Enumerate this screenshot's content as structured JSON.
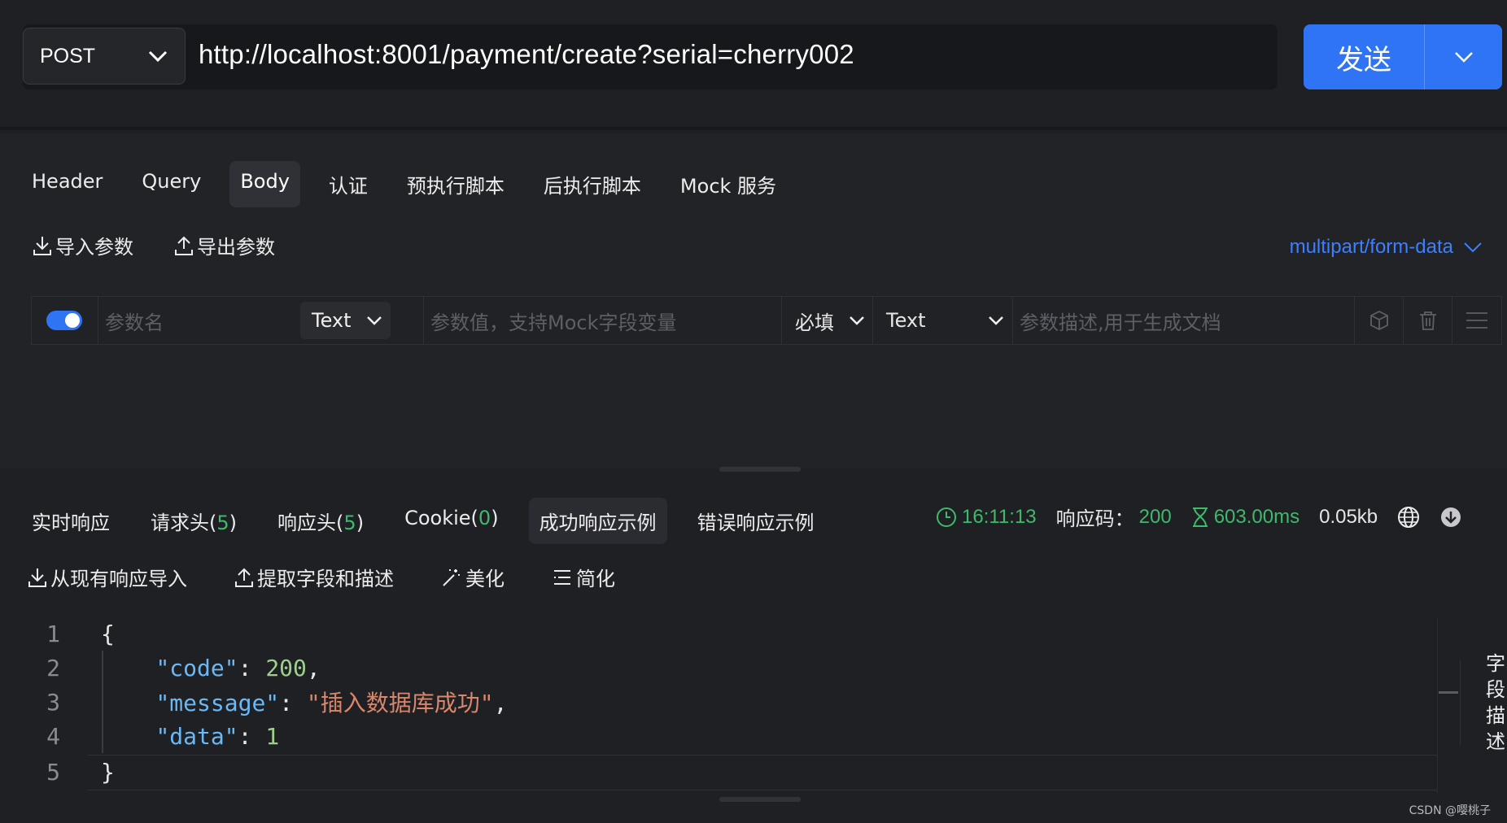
{
  "request": {
    "method": "POST",
    "url": "http://localhost:8001/payment/create?serial=cherry002",
    "send_label": "发送"
  },
  "request_tabs": [
    "Header",
    "Query",
    "Body",
    "认证",
    "预执行脚本",
    "后执行脚本",
    "Mock 服务"
  ],
  "active_request_tab": "Body",
  "body_actions": {
    "import": "导入参数",
    "export": "导出参数"
  },
  "content_type": "multipart/form-data",
  "param_row": {
    "name_placeholder": "参数名",
    "type": "Text",
    "value_placeholder": "参数值，支持Mock字段变量",
    "required": "必填",
    "field_type": "Text",
    "desc_placeholder": "参数描述,用于生成文档"
  },
  "response_tabs": [
    {
      "label": "实时响应",
      "count": ""
    },
    {
      "label": "请求头",
      "count": "5"
    },
    {
      "label": "响应头",
      "count": "5"
    },
    {
      "label": "Cookie",
      "count": "0"
    },
    {
      "label": "成功响应示例",
      "count": ""
    },
    {
      "label": "错误响应示例",
      "count": ""
    }
  ],
  "response_meta": {
    "time": "16:11:13",
    "code_label": "响应码：",
    "code": "200",
    "duration": "603.00ms",
    "size": "0.05kb"
  },
  "response_actions": {
    "import": "从现有响应导入",
    "extract": "提取字段和描述",
    "beautify": "美化",
    "simplify": "简化"
  },
  "code_lines": {
    "l1": "1",
    "l2": "2",
    "l3": "3",
    "l4": "4",
    "l5": "5",
    "key_code": "\"code\"",
    "val_code": "200",
    "key_message": "\"message\"",
    "val_message": "\"插入数据库成功\"",
    "key_data": "\"data\"",
    "val_data": "1"
  },
  "side_label": "字段描述",
  "watermark": "CSDN @嘤桃子",
  "colors": {
    "accent": "#2f74f5",
    "success": "#3fb96a",
    "link": "#3d7fff"
  },
  "icons": [
    "chevron-down-icon",
    "download-icon",
    "upload-icon",
    "clock-icon",
    "hourglass-icon",
    "globe-icon",
    "download-circle-icon",
    "cube-icon",
    "trash-icon",
    "menu-icon",
    "magic-wand-icon",
    "list-icon"
  ]
}
